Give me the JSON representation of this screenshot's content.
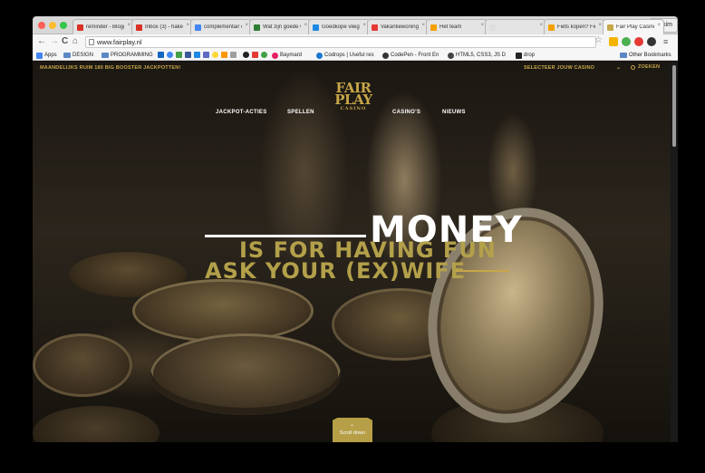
{
  "browser": {
    "tabs": [
      {
        "title": "reminder - Blogg",
        "favicon_color": "#d93025"
      },
      {
        "title": "Inbox (3) - haken",
        "favicon_color": "#d93025"
      },
      {
        "title": "complementair c",
        "favicon_color": "#4285f4"
      },
      {
        "title": "Wat zijn goede w",
        "favicon_color": "#2e7d32"
      },
      {
        "title": "Goedkope vliegti",
        "favicon_color": "#1e88e5"
      },
      {
        "title": "Vakantiewoningen",
        "favicon_color": "#e53935"
      },
      {
        "title": "Het team",
        "favicon_color": "#f4a100"
      },
      {
        "title": "",
        "favicon_color": "#dddddd"
      },
      {
        "title": "Fiets kopen? Fie",
        "favicon_color": "#f4a100"
      },
      {
        "title": "Fair Play Casino",
        "favicon_color": "#c7a749"
      }
    ],
    "profile_name": "Hakim",
    "url": "www.fairplay.nl",
    "bookmarks": {
      "apps": "Apps",
      "design": "DESIGN",
      "programming": "PROGRAMMING",
      "baymard": "Baymard",
      "codrops": "Codrops | Useful res",
      "codepen": "CodePen - Front En",
      "html5": "HTML5, CSS3, JS D",
      "drop": "drop",
      "other": "Other Bookmarks"
    }
  },
  "site": {
    "promo": "MAANDELIJKS RUIM 180 BIG BOOSTER JACKPOTTEN!",
    "select_casino": "SELECTEER JOUW CASINO",
    "search": "ZOEKEN",
    "nav": {
      "jackpot": "JACKPOT-ACTIES",
      "spellen": "SPELLEN",
      "casinos": "CASINO'S",
      "nieuws": "NIEUWS"
    },
    "logo": {
      "line1": "FAIR",
      "line2": "PLAY",
      "line3": "CASINO"
    },
    "headline": "MONEY",
    "subline1": "IS FOR HAVING FUN",
    "subline2": "ASK YOUR (EX)WIFE",
    "scroll_label": "Scroll down"
  },
  "colors": {
    "gold": "#c7a749",
    "scroll_button": "#b79f48"
  }
}
